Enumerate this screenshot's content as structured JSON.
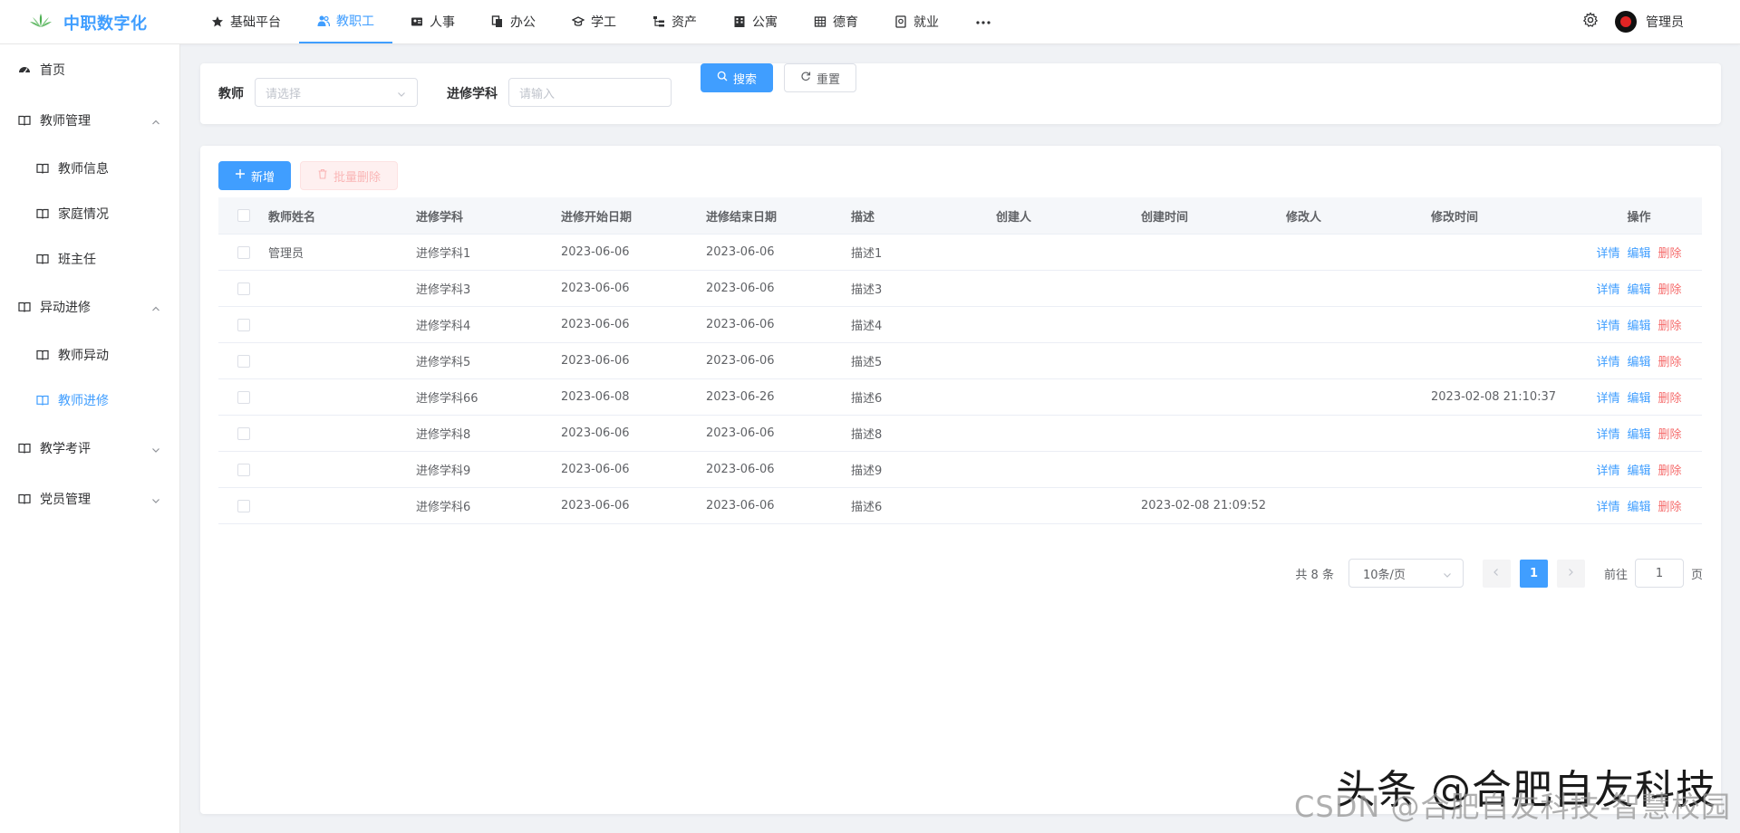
{
  "app": {
    "title": "中职数字化"
  },
  "topnav": [
    {
      "label": "基础平台",
      "icon": "star-icon",
      "active": false
    },
    {
      "label": "教职工",
      "icon": "users-icon",
      "active": true
    },
    {
      "label": "人事",
      "icon": "id-card-icon",
      "active": false
    },
    {
      "label": "办公",
      "icon": "documents-icon",
      "active": false
    },
    {
      "label": "学工",
      "icon": "student-icon",
      "active": false
    },
    {
      "label": "资产",
      "icon": "tree-list-icon",
      "active": false
    },
    {
      "label": "公寓",
      "icon": "building-icon",
      "active": false
    },
    {
      "label": "德育",
      "icon": "grid-icon",
      "active": false
    },
    {
      "label": "就业",
      "icon": "briefcase-icon",
      "active": false
    }
  ],
  "user": {
    "name": "管理员"
  },
  "sidebar": {
    "home": "首页",
    "groups": [
      {
        "label": "教师管理",
        "expanded": true,
        "children": [
          "教师信息",
          "家庭情况",
          "班主任"
        ]
      },
      {
        "label": "异动进修",
        "expanded": true,
        "children": [
          "教师异动",
          "教师进修"
        ]
      },
      {
        "label": "教学考评",
        "expanded": false,
        "children": []
      },
      {
        "label": "党员管理",
        "expanded": false,
        "children": []
      }
    ],
    "active_item": "教师进修"
  },
  "search": {
    "teacher_label": "教师",
    "teacher_placeholder": "请选择",
    "subject_label": "进修学科",
    "subject_placeholder": "请输入",
    "search_btn": "搜索",
    "reset_btn": "重置"
  },
  "toolbar": {
    "add_btn": "新增",
    "batch_delete_btn": "批量删除"
  },
  "table": {
    "columns": [
      "教师姓名",
      "进修学科",
      "进修开始日期",
      "进修结束日期",
      "描述",
      "创建人",
      "创建时间",
      "修改人",
      "修改时间",
      "操作"
    ],
    "rows": [
      {
        "name": "管理员",
        "subject": "进修学科1",
        "start": "2023-06-06",
        "end": "2023-06-06",
        "desc": "描述1",
        "creator": "",
        "created": "",
        "modifier": "",
        "modified": ""
      },
      {
        "name": "",
        "subject": "进修学科3",
        "start": "2023-06-06",
        "end": "2023-06-06",
        "desc": "描述3",
        "creator": "",
        "created": "",
        "modifier": "",
        "modified": ""
      },
      {
        "name": "",
        "subject": "进修学科4",
        "start": "2023-06-06",
        "end": "2023-06-06",
        "desc": "描述4",
        "creator": "",
        "created": "",
        "modifier": "",
        "modified": ""
      },
      {
        "name": "",
        "subject": "进修学科5",
        "start": "2023-06-06",
        "end": "2023-06-06",
        "desc": "描述5",
        "creator": "",
        "created": "",
        "modifier": "",
        "modified": ""
      },
      {
        "name": "",
        "subject": "进修学科66",
        "start": "2023-06-08",
        "end": "2023-06-26",
        "desc": "描述6",
        "creator": "",
        "created": "",
        "modifier": "",
        "modified": "2023-02-08 21:10:37"
      },
      {
        "name": "",
        "subject": "进修学科8",
        "start": "2023-06-06",
        "end": "2023-06-06",
        "desc": "描述8",
        "creator": "",
        "created": "",
        "modifier": "",
        "modified": ""
      },
      {
        "name": "",
        "subject": "进修学科9",
        "start": "2023-06-06",
        "end": "2023-06-06",
        "desc": "描述9",
        "creator": "",
        "created": "",
        "modifier": "",
        "modified": ""
      },
      {
        "name": "",
        "subject": "进修学科6",
        "start": "2023-06-06",
        "end": "2023-06-06",
        "desc": "描述6",
        "creator": "",
        "created": "2023-02-08 21:09:52",
        "modifier": "",
        "modified": ""
      }
    ],
    "actions": {
      "detail": "详情",
      "edit": "编辑",
      "delete": "删除"
    }
  },
  "pagination": {
    "total": "共 8 条",
    "page_size": "10条/页",
    "current_page": "1",
    "goto_prefix": "前往",
    "goto_value": "1",
    "goto_suffix": "页"
  },
  "watermark": {
    "line1": "头条 @合肥自友科技",
    "line2": "CSDN @合肥自友科技-智慧校园"
  },
  "colors": {
    "primary": "#409eff",
    "danger": "#f56c6c",
    "logo_green": "#4caf50"
  }
}
